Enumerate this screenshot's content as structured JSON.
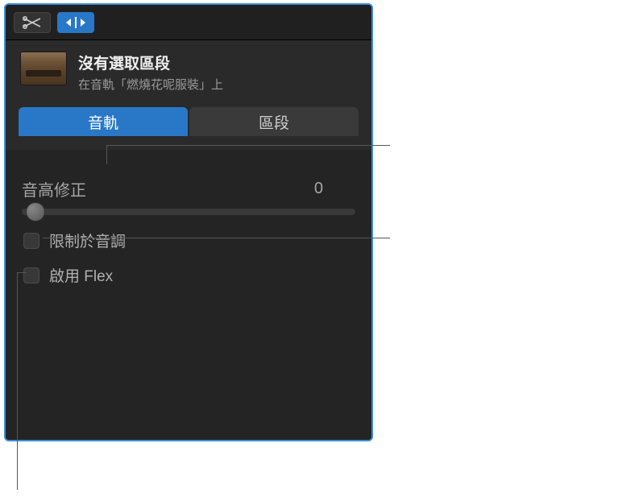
{
  "header": {
    "title": "沒有選取區段",
    "subtitle": "在音軌「燃燒花呢服裝」上"
  },
  "tabs": [
    {
      "label": "音軌",
      "active": true
    },
    {
      "label": "區段",
      "active": false
    }
  ],
  "pitch_correction": {
    "label": "音高修正",
    "value": "0"
  },
  "checkboxes": {
    "limit_to_key": "限制於音調",
    "enable_flex": "啟用 Flex"
  }
}
